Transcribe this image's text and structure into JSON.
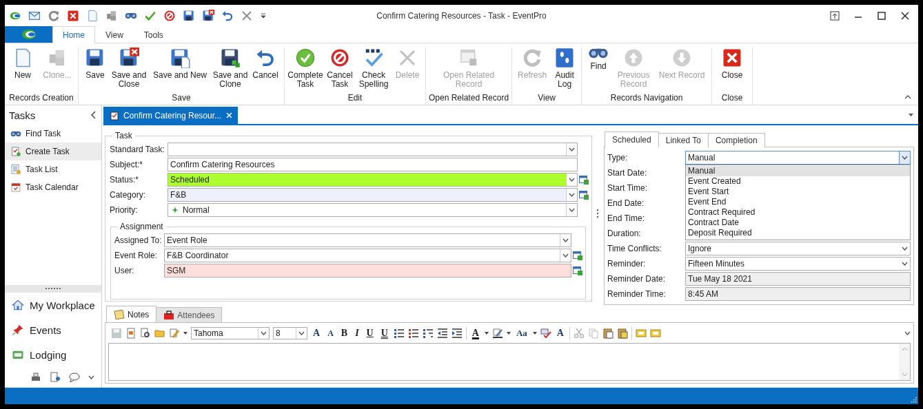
{
  "window": {
    "title": "Confirm Catering Resources - Task - EventPro"
  },
  "ribbon": {
    "tabs": [
      {
        "label": "Home",
        "selected": true
      },
      {
        "label": "View",
        "selected": false
      },
      {
        "label": "Tools",
        "selected": false
      }
    ],
    "groups": [
      {
        "title": "Records Creation",
        "buttons": [
          {
            "label": "New",
            "disabled": false
          },
          {
            "label": "Clone...",
            "disabled": true
          }
        ]
      },
      {
        "title": "Save",
        "buttons": [
          {
            "label": "Save",
            "disabled": false
          },
          {
            "label": "Save and Close",
            "disabled": false
          },
          {
            "label": "Save and New",
            "disabled": false
          },
          {
            "label": "Save and Clone",
            "disabled": false
          },
          {
            "label": "Cancel",
            "disabled": false
          }
        ]
      },
      {
        "title": "Edit",
        "buttons": [
          {
            "label": "Complete Task",
            "disabled": false
          },
          {
            "label": "Cancel Task",
            "disabled": false
          },
          {
            "label": "Check Spelling",
            "disabled": false
          },
          {
            "label": "Delete",
            "disabled": true
          }
        ]
      },
      {
        "title": "Open Related Record",
        "buttons": [
          {
            "label": "Open Related Record",
            "disabled": true
          }
        ]
      },
      {
        "title": "View",
        "buttons": [
          {
            "label": "Refresh",
            "disabled": true
          },
          {
            "label": "Audit Log",
            "disabled": false
          }
        ]
      },
      {
        "title": "Records Navigation",
        "buttons": [
          {
            "label": "Find",
            "disabled": false
          },
          {
            "label": "Previous Record",
            "disabled": true
          },
          {
            "label": "Next Record",
            "disabled": true
          }
        ]
      },
      {
        "title": "Close",
        "buttons": [
          {
            "label": "Close",
            "disabled": false
          }
        ]
      }
    ]
  },
  "sidebar": {
    "title": "Tasks",
    "items": [
      {
        "label": "Find Task",
        "selected": false
      },
      {
        "label": "Create Task",
        "selected": true
      },
      {
        "label": "Task List",
        "selected": false
      },
      {
        "label": "Task Calendar",
        "selected": false
      }
    ],
    "nav": [
      {
        "label": "My Workplace"
      },
      {
        "label": "Events"
      },
      {
        "label": "Lodging"
      }
    ]
  },
  "document_tabs": [
    {
      "label": "Confirm Catering Resour...",
      "selected": true
    }
  ],
  "task": {
    "title": "Task",
    "fields": [
      {
        "label": "Standard Task:",
        "kind": "combo",
        "lookup": false,
        "color": "#ffffff"
      },
      {
        "label": "Subject:*",
        "value": "Confirm Catering Resources",
        "kind": "text",
        "lookup": false,
        "color": "#ffffff"
      },
      {
        "label": "Status:*",
        "value": "Scheduled",
        "kind": "combo",
        "lookup": true,
        "color": "#adff2f"
      },
      {
        "label": "Category:",
        "value": "F&B",
        "kind": "combo",
        "lookup": true,
        "color": "#eef0fb"
      },
      {
        "label": "Priority:",
        "value": "Normal",
        "kind": "priority",
        "lookup": false,
        "color": "#ffffff"
      }
    ],
    "assignment": {
      "title": "Assignment",
      "fields": [
        {
          "label": "Assigned To:",
          "value": "Event Role",
          "kind": "combo",
          "lookup": false,
          "color": "#ffffff"
        },
        {
          "label": "Event Role:",
          "value": "F&B Coordinator",
          "kind": "combo",
          "lookup": true,
          "color": "#ffffff"
        },
        {
          "label": "User:",
          "value": "SGM",
          "kind": "text",
          "lookup": true,
          "color": "#ffdede"
        }
      ]
    }
  },
  "schedule": {
    "tabs": [
      {
        "label": "Scheduled",
        "selected": true
      },
      {
        "label": "Linked To",
        "selected": false
      },
      {
        "label": "Completion",
        "selected": false
      }
    ],
    "fields": [
      {
        "label": "Type:",
        "value": "Manual",
        "kind": "open"
      },
      {
        "label": "Start Date:",
        "kind": "covered"
      },
      {
        "label": "Start Time:",
        "kind": "covered"
      },
      {
        "label": "End Date:",
        "kind": "covered"
      },
      {
        "label": "End Time:",
        "kind": "covered"
      },
      {
        "label": "Duration:",
        "kind": "covered"
      },
      {
        "label": "Time Conflicts:",
        "value": "Ignore",
        "kind": "combo"
      },
      {
        "label": "Reminder:",
        "value": "Fifteen Minutes",
        "kind": "combo"
      },
      {
        "label": "Reminder Date:",
        "value": "Tue May 18 2021",
        "kind": "readonly"
      },
      {
        "label": "Reminder Time:",
        "value": "8:45 AM",
        "kind": "readonly"
      }
    ],
    "dropdown": [
      {
        "label": "Manual",
        "selected": true
      },
      {
        "label": "Event Created",
        "selected": false
      },
      {
        "label": "Event Start",
        "selected": false
      },
      {
        "label": "Event End",
        "selected": false
      },
      {
        "label": "Contract Required",
        "selected": false
      },
      {
        "label": "Contract Date",
        "selected": false
      },
      {
        "label": "Deposit Required",
        "selected": false
      }
    ]
  },
  "notes_tabs": [
    {
      "label": "Notes",
      "selected": true
    },
    {
      "label": "Attendees",
      "selected": false
    }
  ],
  "editor": {
    "font": "Tahoma",
    "size": "8",
    "glyphs": [
      "A",
      "A",
      "B",
      "I",
      "U",
      "U",
      "A",
      "Aa",
      "A"
    ]
  }
}
